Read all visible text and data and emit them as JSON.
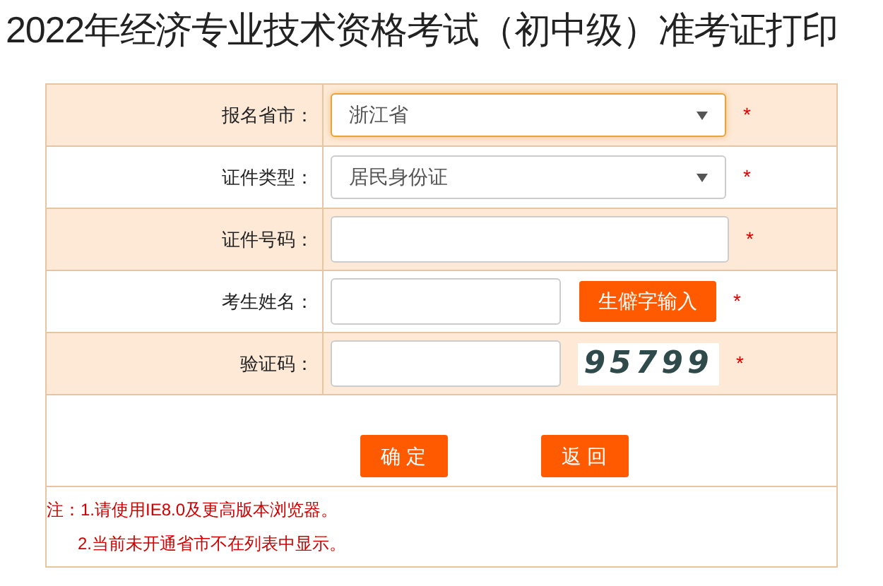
{
  "title": "2022年经济专业技术资格考试（初中级）准考证打印",
  "rows": [
    {
      "label": "报名省市：",
      "kind": "select",
      "value": "浙江省",
      "focused": true,
      "required_mark": "*"
    },
    {
      "label": "证件类型：",
      "kind": "select",
      "value": "居民身份证",
      "focused": false,
      "required_mark": "*"
    },
    {
      "label": "证件号码：",
      "kind": "text",
      "required_mark": "*"
    },
    {
      "label": "考生姓名：",
      "kind": "text_button",
      "button": "生僻字输入",
      "required_mark": "*"
    },
    {
      "label": "验证码：",
      "kind": "captcha",
      "captcha": "95799",
      "required_mark": "*"
    }
  ],
  "buttons": [
    "确 定",
    "返 回"
  ],
  "notes": [
    "注：1.请使用IE8.0及更高版本浏览器。",
    "2.当前未开通省市不在列表中显示。"
  ]
}
